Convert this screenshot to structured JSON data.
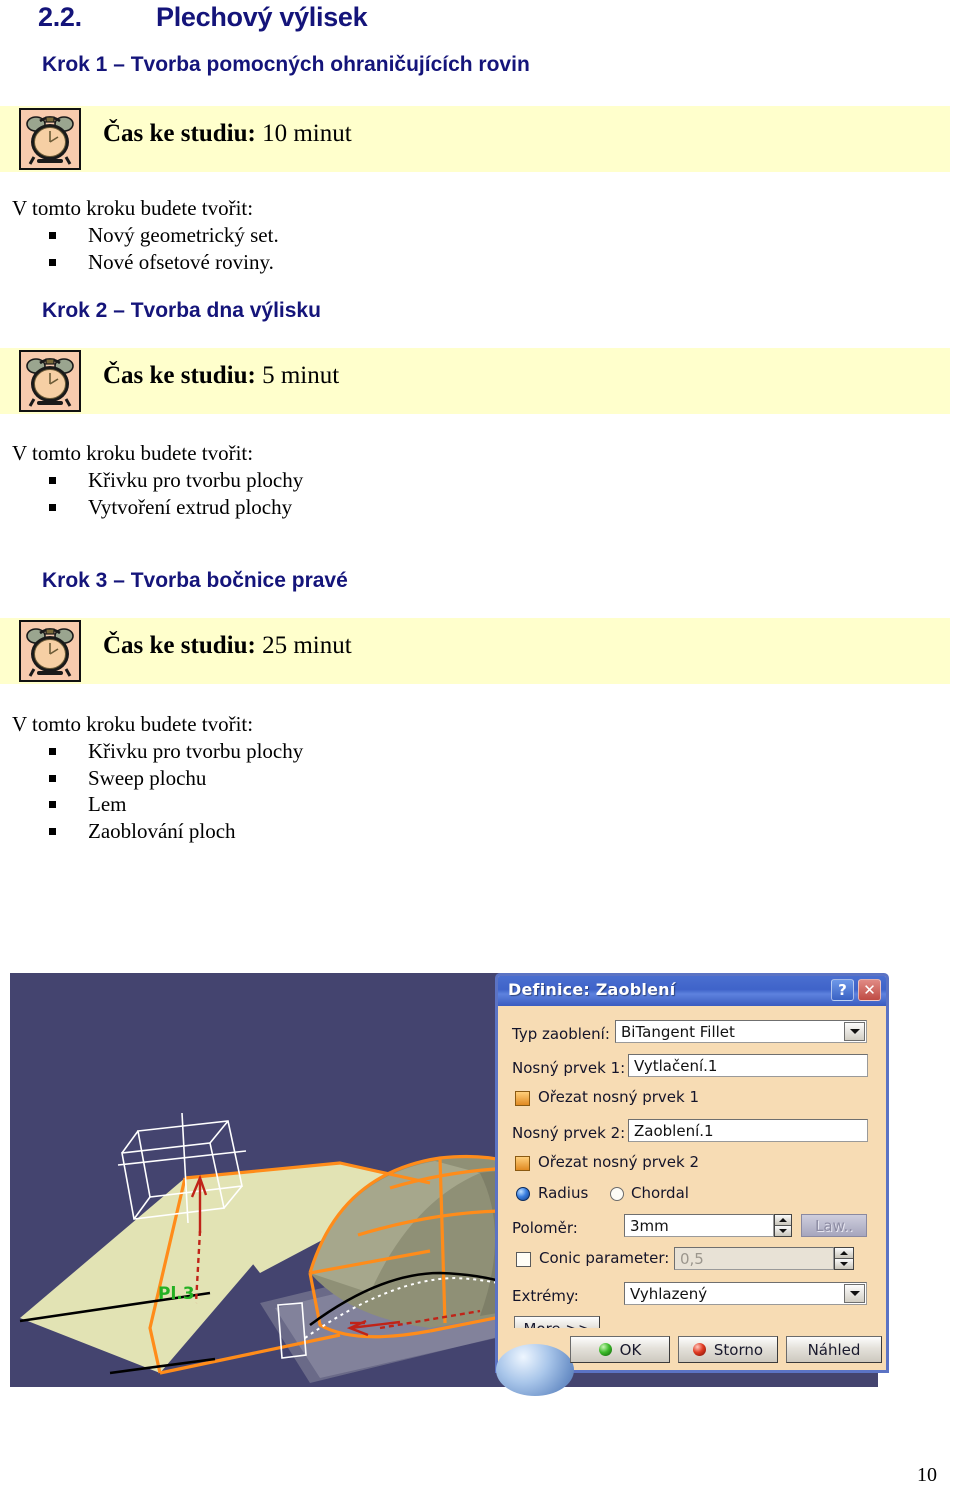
{
  "document": {
    "title_number": "2.2.",
    "title_text": "Plechový výlisek",
    "page_number": "10"
  },
  "sections": [
    {
      "heading": "Krok 1 – Tvorba pomocných ohraničujících rovin",
      "time_label": "Čas ke studiu:",
      "time_value": "10 minut",
      "clock_icon": "alarm-clock-icon",
      "intro": "V tomto kroku budete tvořit:",
      "bullets": [
        "Nový geometrický set.",
        "Nové ofsetové roviny."
      ]
    },
    {
      "heading": "Krok 2 – Tvorba dna výlisku",
      "time_label": "Čas ke studiu:",
      "time_value": "5 minut",
      "clock_icon": "alarm-clock-icon",
      "intro": "V tomto kroku budete tvořit:",
      "bullets": [
        "Křivku pro tvorbu plochy",
        "Vytvoření extrud plochy"
      ]
    },
    {
      "heading": "Krok 3 – Tvorba bočnice pravé",
      "time_label": "Čas ke studiu:",
      "time_value": "25 minut",
      "clock_icon": "alarm-clock-icon",
      "intro": "V tomto kroku budete tvořit:",
      "bullets": [
        "Křivku pro tvorbu plochy",
        "Sweep plochu",
        "Lem",
        "Zaoblování ploch"
      ]
    }
  ],
  "screenshot": {
    "viewport_background": "#44446f",
    "dialog": {
      "title": "Definice: Zaoblení",
      "help_button": "?",
      "close_button": "✕",
      "fields": {
        "fillet_type_label": "Typ zaoblení:",
        "fillet_type_value": "BiTangent Fillet",
        "support1_label": "Nosný prvek 1:",
        "support1_value": "Vytlačení.1",
        "trim1_label": "Ořezat nosný prvek 1",
        "support2_label": "Nosný prvek 2:",
        "support2_value": "Zaoblení.1",
        "trim2_label": "Ořezat nosný prvek 2",
        "radius_radio_label": "Radius",
        "chordal_radio_label": "Chordal",
        "radius_label": "Poloměr:",
        "radius_value": "3mm",
        "law_button": "Law..",
        "conic_label": "Conic parameter:",
        "conic_value": "0,5",
        "extremities_label": "Extrémy:",
        "extremities_value": "Vyhlazený",
        "more_button": "More >>"
      },
      "buttons": {
        "ok": "OK",
        "cancel": "Storno",
        "preview": "Náhled"
      }
    }
  },
  "colors": {
    "heading_navy": "#14147a",
    "band_yellow": "#ffffcc",
    "clock_bg": "#f8cbae",
    "dialog_face": "#f7dcb4",
    "dialog_border": "#5b73c4",
    "model_highlight_orange": "#ff8c1a"
  }
}
